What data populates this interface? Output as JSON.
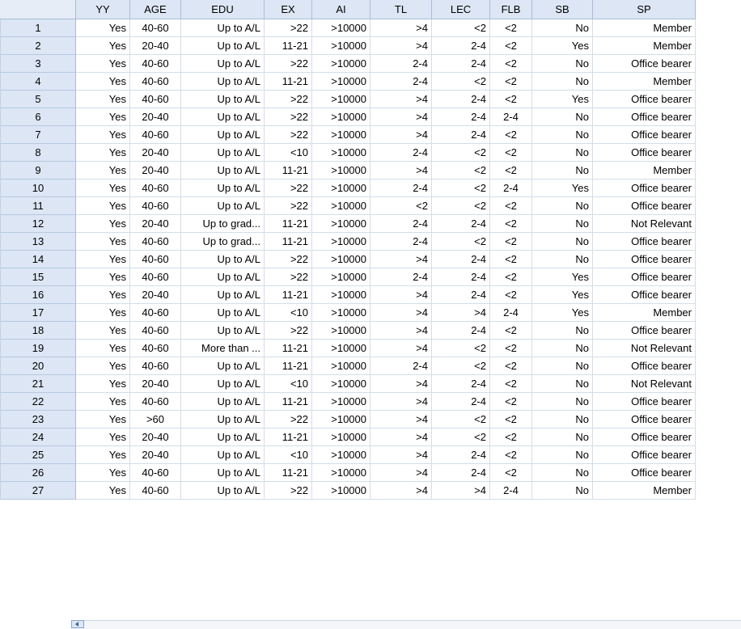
{
  "columns": [
    "",
    "YY",
    "AGE",
    "EDU",
    "EX",
    "AI",
    "TL",
    "LEC",
    "FLB",
    "SB",
    "SP"
  ],
  "rows": [
    [
      "1",
      "Yes",
      "40-60",
      "Up to A/L",
      ">22",
      ">10000",
      ">4",
      "<2",
      "<2",
      "No",
      "Member"
    ],
    [
      "2",
      "Yes",
      "20-40",
      "Up to A/L",
      "11-21",
      ">10000",
      ">4",
      "2-4",
      "<2",
      "Yes",
      "Member"
    ],
    [
      "3",
      "Yes",
      "40-60",
      "Up to A/L",
      ">22",
      ">10000",
      "2-4",
      "2-4",
      "<2",
      "No",
      "Office bearer"
    ],
    [
      "4",
      "Yes",
      "40-60",
      "Up to A/L",
      "11-21",
      ">10000",
      "2-4",
      "<2",
      "<2",
      "No",
      "Member"
    ],
    [
      "5",
      "Yes",
      "40-60",
      "Up to A/L",
      ">22",
      ">10000",
      ">4",
      "2-4",
      "<2",
      "Yes",
      "Office bearer"
    ],
    [
      "6",
      "Yes",
      "20-40",
      "Up to A/L",
      ">22",
      ">10000",
      ">4",
      "2-4",
      "2-4",
      "No",
      "Office bearer"
    ],
    [
      "7",
      "Yes",
      "40-60",
      "Up to A/L",
      ">22",
      ">10000",
      ">4",
      "2-4",
      "<2",
      "No",
      "Office bearer"
    ],
    [
      "8",
      "Yes",
      "20-40",
      "Up to A/L",
      "<10",
      ">10000",
      "2-4",
      "<2",
      "<2",
      "No",
      "Office bearer"
    ],
    [
      "9",
      "Yes",
      "20-40",
      "Up to A/L",
      "11-21",
      ">10000",
      ">4",
      "<2",
      "<2",
      "No",
      "Member"
    ],
    [
      "10",
      "Yes",
      "40-60",
      "Up to A/L",
      ">22",
      ">10000",
      "2-4",
      "<2",
      "2-4",
      "Yes",
      "Office bearer"
    ],
    [
      "11",
      "Yes",
      "40-60",
      "Up to A/L",
      ">22",
      ">10000",
      "<2",
      "<2",
      "<2",
      "No",
      "Office bearer"
    ],
    [
      "12",
      "Yes",
      "20-40",
      "Up to grad...",
      "11-21",
      ">10000",
      "2-4",
      "2-4",
      "<2",
      "No",
      "Not Relevant"
    ],
    [
      "13",
      "Yes",
      "40-60",
      "Up to grad...",
      "11-21",
      ">10000",
      "2-4",
      "<2",
      "<2",
      "No",
      "Office bearer"
    ],
    [
      "14",
      "Yes",
      "40-60",
      "Up to A/L",
      ">22",
      ">10000",
      ">4",
      "2-4",
      "<2",
      "No",
      "Office bearer"
    ],
    [
      "15",
      "Yes",
      "40-60",
      "Up to A/L",
      ">22",
      ">10000",
      "2-4",
      "2-4",
      "<2",
      "Yes",
      "Office bearer"
    ],
    [
      "16",
      "Yes",
      "20-40",
      "Up to A/L",
      "11-21",
      ">10000",
      ">4",
      "2-4",
      "<2",
      "Yes",
      "Office bearer"
    ],
    [
      "17",
      "Yes",
      "40-60",
      "Up to A/L",
      "<10",
      ">10000",
      ">4",
      ">4",
      "2-4",
      "Yes",
      "Member"
    ],
    [
      "18",
      "Yes",
      "40-60",
      "Up to A/L",
      ">22",
      ">10000",
      ">4",
      "2-4",
      "<2",
      "No",
      "Office bearer"
    ],
    [
      "19",
      "Yes",
      "40-60",
      "More than ...",
      "11-21",
      ">10000",
      ">4",
      "<2",
      "<2",
      "No",
      "Not Relevant"
    ],
    [
      "20",
      "Yes",
      "40-60",
      "Up to A/L",
      "11-21",
      ">10000",
      "2-4",
      "<2",
      "<2",
      "No",
      "Office bearer"
    ],
    [
      "21",
      "Yes",
      "20-40",
      "Up to A/L",
      "<10",
      ">10000",
      ">4",
      "2-4",
      "<2",
      "No",
      "Not Relevant"
    ],
    [
      "22",
      "Yes",
      "40-60",
      "Up to A/L",
      "11-21",
      ">10000",
      ">4",
      "2-4",
      "<2",
      "No",
      "Office bearer"
    ],
    [
      "23",
      "Yes",
      ">60",
      "Up to A/L",
      ">22",
      ">10000",
      ">4",
      "<2",
      "<2",
      "No",
      "Office bearer"
    ],
    [
      "24",
      "Yes",
      "20-40",
      "Up to A/L",
      "11-21",
      ">10000",
      ">4",
      "<2",
      "<2",
      "No",
      "Office bearer"
    ],
    [
      "25",
      "Yes",
      "20-40",
      "Up to A/L",
      "<10",
      ">10000",
      ">4",
      "2-4",
      "<2",
      "No",
      "Office bearer"
    ],
    [
      "26",
      "Yes",
      "40-60",
      "Up to A/L",
      "11-21",
      ">10000",
      ">4",
      "2-4",
      "<2",
      "No",
      "Office bearer"
    ],
    [
      "27",
      "Yes",
      "40-60",
      "Up to A/L",
      ">22",
      ">10000",
      ">4",
      ">4",
      "2-4",
      "No",
      "Member"
    ]
  ],
  "colors": {
    "header_bg": "#dce6f4",
    "grid_line": "#d3dde9",
    "header_border": "#a9bcd6"
  },
  "scrollbar": {
    "icon": "chevron-left-icon"
  }
}
